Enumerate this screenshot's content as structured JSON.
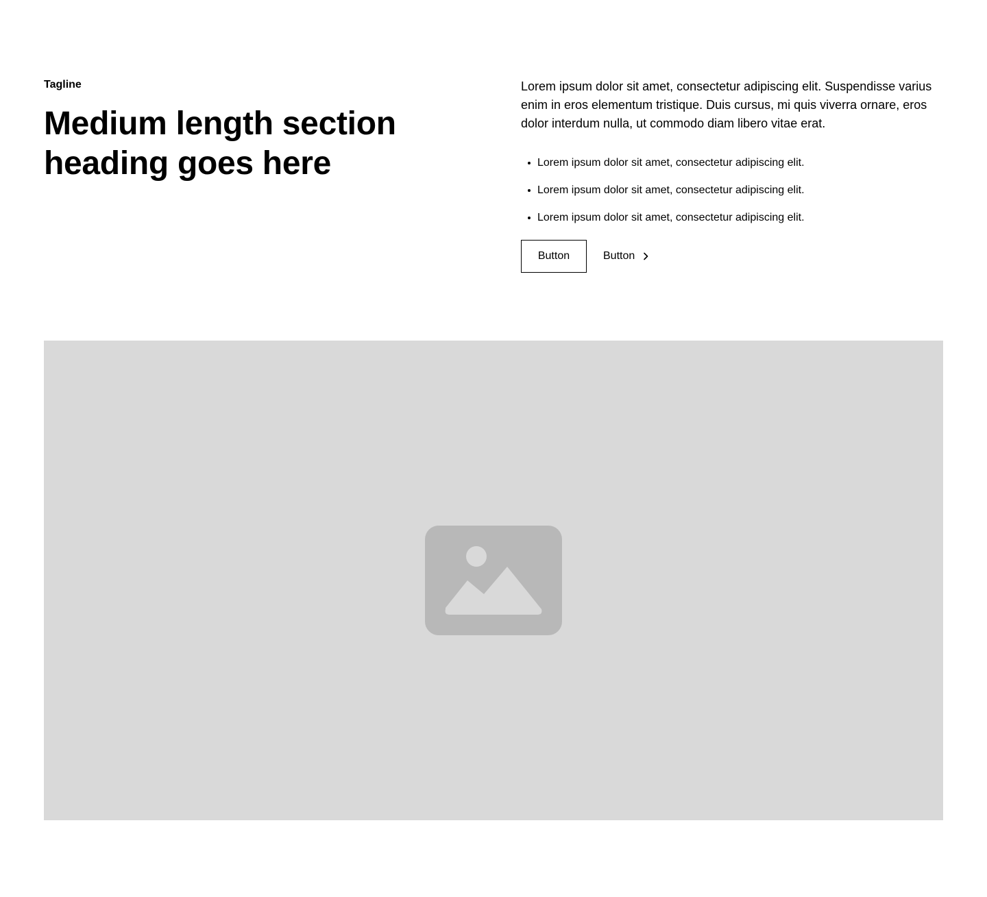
{
  "header": {
    "tagline": "Tagline",
    "heading": "Medium length section heading goes here"
  },
  "content": {
    "paragraph": "Lorem ipsum dolor sit amet, consectetur adipiscing elit. Suspendisse varius enim in eros elementum tristique. Duis cursus, mi quis viverra ornare, eros dolor interdum nulla, ut commodo diam libero vitae erat.",
    "bullets": [
      "Lorem ipsum dolor sit amet, consectetur adipiscing elit.",
      "Lorem ipsum dolor sit amet, consectetur adipiscing elit.",
      "Lorem ipsum dolor sit amet, consectetur adipiscing elit."
    ]
  },
  "actions": {
    "primary_label": "Button",
    "secondary_label": "Button"
  },
  "media": {
    "icon": "image-icon",
    "placeholder_color": "#d9d9d9",
    "icon_color": "#b8b8b8"
  }
}
